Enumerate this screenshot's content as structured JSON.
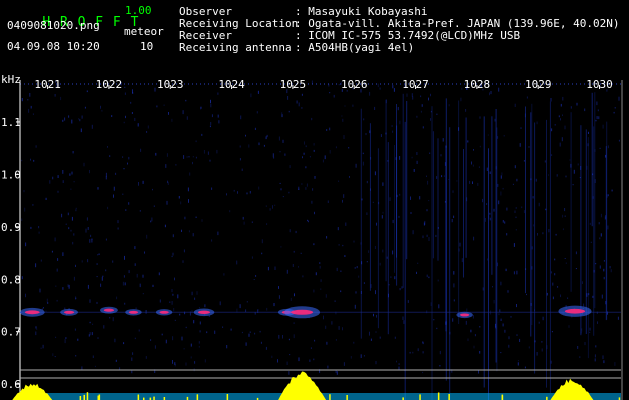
{
  "header": {
    "app_title": "H R O F F T",
    "version": "1.00",
    "filename": "0409081020.png",
    "datetime": "04.09.08 10:20",
    "count_label": "meteor",
    "count_value": "10",
    "info": [
      {
        "label": "Observer",
        "value": ": Masayuki Kobayashi"
      },
      {
        "label": "Receiving Location",
        "value": ": Ogata-vill. Akita-Pref. JAPAN (139.96E, 40.02N)"
      },
      {
        "label": "Receiver",
        "value": ": ICOM IC-575 53.7492(@LCD)MHz USB"
      },
      {
        "label": "Receiving antenna",
        "value": ": A504HB(yagi 4el)"
      }
    ]
  },
  "colors": {
    "background": "#000000",
    "header_text": "#ffffff",
    "title_text": "#00ff00",
    "axis_text": "#ffffff",
    "spectrum": "#ffff00",
    "noise": "#1a2fb0",
    "echo_core": "#ff2a7a",
    "echo_halo": "#3a6bff",
    "baseline": "#00b7ff"
  },
  "chart_data": {
    "type": "heatmap",
    "title": "",
    "xlabel": "",
    "ylabel": "kHz",
    "x_tick_labels": [
      "1021",
      "1022",
      "1023",
      "1024",
      "1025",
      "1026",
      "1027",
      "1028",
      "1029",
      "1030"
    ],
    "y_tick_labels": [
      "1.1",
      "1.0",
      "0.9",
      "0.8",
      "0.7",
      "0.6"
    ],
    "y_ticks": [
      1.1,
      1.0,
      0.9,
      0.8,
      0.7,
      0.6
    ],
    "ylim": [
      0.585,
      1.18
    ],
    "x_range": [
      1020.55,
      1030.35
    ],
    "meteor_echoes": [
      {
        "time": 1020.75,
        "freq": 0.737,
        "intensity": 0.6
      },
      {
        "time": 1021.35,
        "freq": 0.737,
        "intensity": 0.35
      },
      {
        "time": 1022.0,
        "freq": 0.741,
        "intensity": 0.35
      },
      {
        "time": 1022.4,
        "freq": 0.737,
        "intensity": 0.3
      },
      {
        "time": 1022.9,
        "freq": 0.737,
        "intensity": 0.3
      },
      {
        "time": 1023.55,
        "freq": 0.737,
        "intensity": 0.45
      },
      {
        "time": 1024.9,
        "freq": 0.737,
        "intensity": 0.35
      },
      {
        "time": 1025.15,
        "freq": 0.737,
        "intensity": 1.0
      },
      {
        "time": 1027.8,
        "freq": 0.732,
        "intensity": 0.3
      },
      {
        "time": 1029.6,
        "freq": 0.739,
        "intensity": 0.9
      }
    ],
    "spectrum_peaks": [
      {
        "time": 1020.75,
        "height": 0.6
      },
      {
        "time": 1025.15,
        "height": 1.0
      },
      {
        "time": 1029.55,
        "height": 0.75
      }
    ]
  }
}
